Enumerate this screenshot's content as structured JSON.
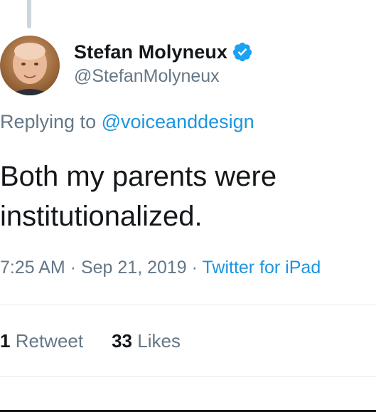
{
  "tweet": {
    "display_name": "Stefan Molyneux",
    "handle": "@StefanMolyneux",
    "verified": true,
    "replying_prefix": "Replying to",
    "replying_to": "@voiceanddesign",
    "text": "Both my parents were institutionalized.",
    "time": "7:25 AM",
    "separator": "·",
    "date": "Sep 21, 2019",
    "source": "Twitter for iPad",
    "stats": {
      "retweet_count": "1",
      "retweet_label": "Retweet",
      "likes_count": "33",
      "likes_label": "Likes"
    }
  },
  "icons": {
    "avatar": "user-avatar",
    "verified": "verified-badge-icon"
  },
  "colors": {
    "link_blue": "#1b95e0",
    "muted_gray": "#657786",
    "text_dark": "#14171a",
    "divider": "#e6ecf0"
  }
}
